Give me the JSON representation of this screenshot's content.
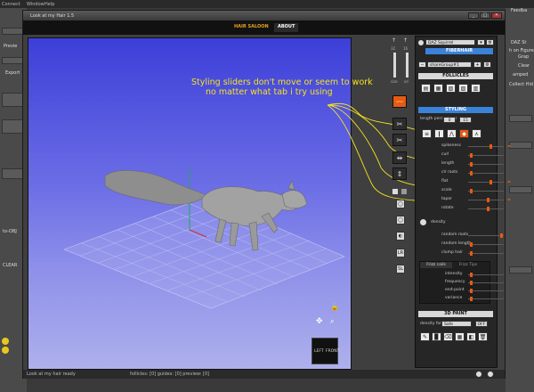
{
  "host": {
    "menu": [
      "Connect",
      "Window",
      "Help"
    ],
    "left_labels": [
      "Previe",
      "Export",
      "to-OBJ",
      "CLEAR"
    ],
    "right_labels": [
      "Feedba",
      "DAZ St",
      "h on Figure",
      "Grap",
      "Clear",
      "amped",
      "Collect Hid"
    ],
    "pick_label": "LINEAR"
  },
  "dialog": {
    "title": "Look at my Hair 1.5",
    "tabs": [
      {
        "label": "HAIR SALOON",
        "active": false
      },
      {
        "label": "ABOUT",
        "active": true
      }
    ]
  },
  "annotation": {
    "line1": "Styling sliders don't move or seem to work",
    "line2": "no matter what tab i try using"
  },
  "viewport": {
    "cube_left": "LEFT",
    "cube_front": "FRONT"
  },
  "tools": {
    "left_num": "32",
    "right_num": "16",
    "size_labels": [
      "size",
      "ori"
    ],
    "bottom_labels": [
      "LR",
      "SL"
    ]
  },
  "panel": {
    "figure": "DAZ Squirrel",
    "fiberhair": "FIBERHAIR",
    "group": "shareGroup#1",
    "follicles_header": "FOLLICLES",
    "styling_header": "STYLING",
    "length_label": "length percentage",
    "length_min": "0",
    "length_max": "15",
    "sliders": [
      {
        "label": "spikeness",
        "value": 0.62
      },
      {
        "label": "curl",
        "value": 0.05
      },
      {
        "label": "length",
        "value": 0.05
      },
      {
        "label": "clr roots",
        "value": 0.05
      },
      {
        "label": "flat",
        "value": 0.62
      },
      {
        "label": "scale",
        "value": 0.05
      },
      {
        "label": "taper",
        "value": 0.55
      },
      {
        "label": "rotate",
        "value": 0.55
      }
    ],
    "density_label": "density",
    "random_sliders": [
      {
        "label": "random roots",
        "value": 0.95
      },
      {
        "label": "random length",
        "value": 0.05
      },
      {
        "label": "clump hair",
        "value": 0.05
      }
    ],
    "sub_tabs": [
      "Frizz coils",
      "Frizz Tips"
    ],
    "frizz_sliders": [
      {
        "label": "intensity",
        "value": 0.05
      },
      {
        "label": "frequency",
        "value": 0.05
      },
      {
        "label": "end-point",
        "value": 0.05
      },
      {
        "label": "variance",
        "value": 0.05
      }
    ],
    "paint_header": "3D PAINT",
    "density_for": "density for",
    "density_select": "Safe",
    "off_label": "OFF"
  },
  "status": {
    "left": "Look at my hair ready",
    "right": "follicles: [0]  guides: [0]  preview: [0]"
  },
  "colors": {
    "accent": "#e85a12",
    "annotation": "#f4e21e",
    "header_blue": "#3b82d9"
  }
}
